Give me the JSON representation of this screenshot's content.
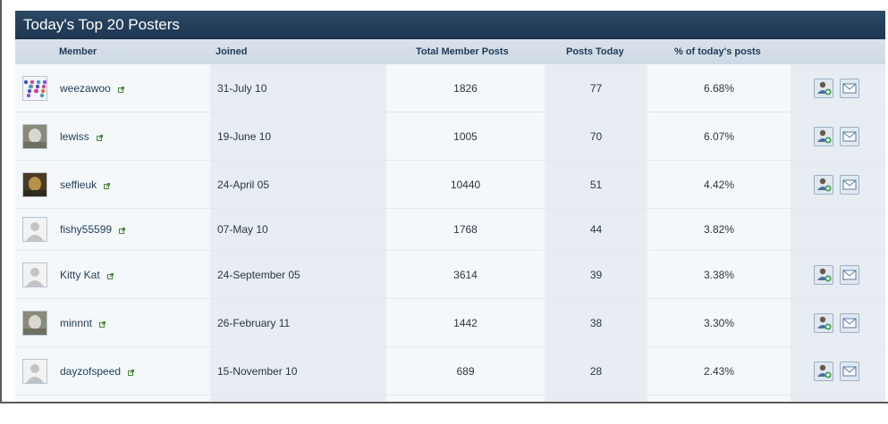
{
  "title": "Today's Top 20 Posters",
  "columns": {
    "member": "Member",
    "joined": "Joined",
    "total": "Total Member Posts",
    "today": "Posts Today",
    "pct": "% of today's posts"
  },
  "rows": [
    {
      "member": "weezawoo",
      "joined": "31-July 10",
      "total": "1826",
      "today": "77",
      "pct": "6.68%",
      "avatar": "pattern-avatar",
      "actions": true
    },
    {
      "member": "lewiss",
      "joined": "19-June 10",
      "total": "1005",
      "today": "70",
      "pct": "6.07%",
      "avatar": "photo-avatar",
      "actions": true
    },
    {
      "member": "seffieuk",
      "joined": "24-April 05",
      "total": "10440",
      "today": "51",
      "pct": "4.42%",
      "avatar": "photo-avatar",
      "actions": true
    },
    {
      "member": "fishy55599",
      "joined": "07-May 10",
      "total": "1768",
      "today": "44",
      "pct": "3.82%",
      "avatar": "default-avatar",
      "actions": false
    },
    {
      "member": "Kitty Kat",
      "joined": "24-September 05",
      "total": "3614",
      "today": "39",
      "pct": "3.38%",
      "avatar": "default-avatar",
      "actions": true
    },
    {
      "member": "minnnt",
      "joined": "26-February 11",
      "total": "1442",
      "today": "38",
      "pct": "3.30%",
      "avatar": "photo-avatar",
      "actions": true
    },
    {
      "member": "dayzofspeed",
      "joined": "15-November 10",
      "total": "689",
      "today": "28",
      "pct": "2.43%",
      "avatar": "default-avatar",
      "actions": true
    },
    {
      "member": "",
      "joined": "",
      "total": "",
      "today": "",
      "pct": "",
      "avatar": "",
      "actions": false
    }
  ],
  "icons": {
    "external": "external-link-icon",
    "add_friend": "add-friend-icon",
    "send_message": "send-message-icon"
  },
  "colors": {
    "title_bg": "#1f3a57",
    "header_bg": "#d3dde8",
    "link": "#1e3b59"
  }
}
